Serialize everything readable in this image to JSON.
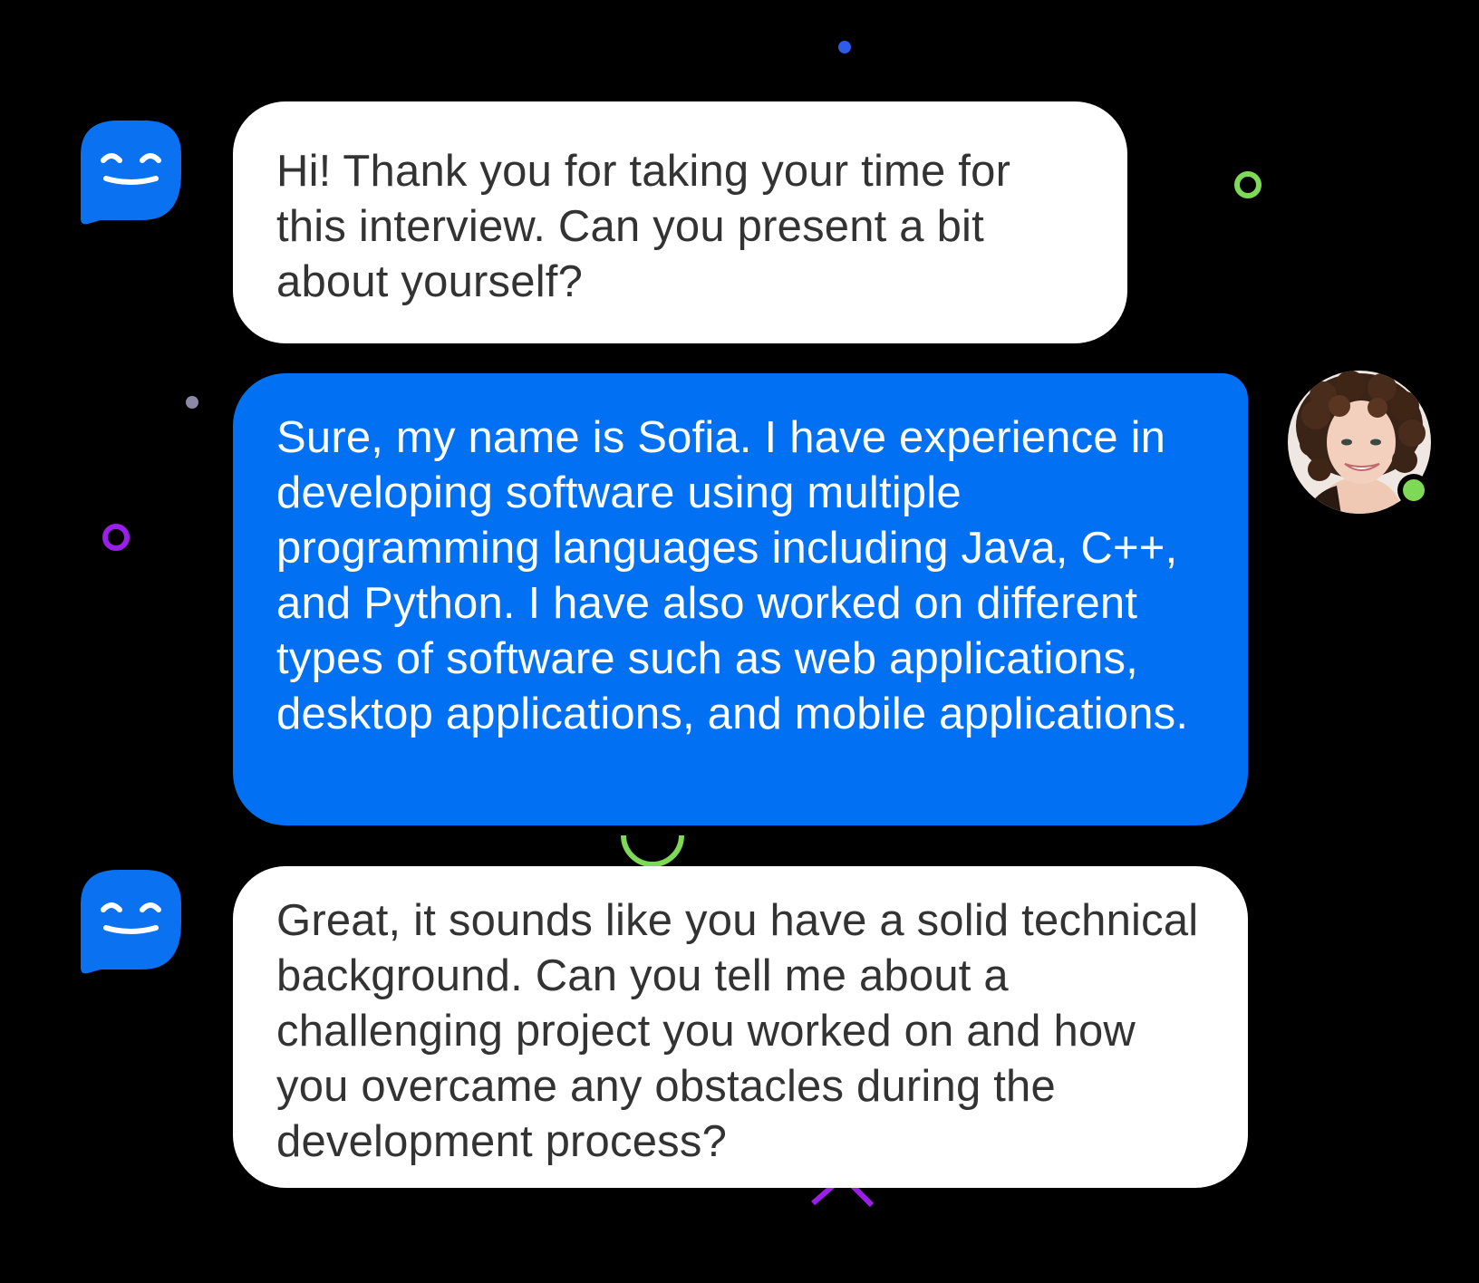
{
  "conversation": {
    "messages": [
      {
        "sender": "bot",
        "text": "Hi! Thank you for taking your time for this interview. Can you present a bit about yourself?"
      },
      {
        "sender": "user",
        "text": "Sure, my name is Sofia. I have experience in developing software using multiple programming languages including Java, C++, and Python. I have also worked on different types of software such as web applications, desktop applications, and mobile applications."
      },
      {
        "sender": "bot",
        "text": "Great, it sounds like you have a solid technical background. Can you tell me about a challenging project you worked on and how you overcame any obstacles during the development process?"
      }
    ],
    "user": {
      "status": "online",
      "status_color": "#7ed957"
    }
  },
  "theme": {
    "background": "#000000",
    "bot_bubble": "#ffffff",
    "bot_text": "#333333",
    "user_bubble": "#0170f3",
    "user_text": "#ffffff",
    "bot_avatar": "#0a72f0"
  },
  "icons": {
    "bot_avatar": "smiling-chat-bubble-icon",
    "user_avatar": "user-photo-avatar",
    "status": "online-dot-icon"
  }
}
